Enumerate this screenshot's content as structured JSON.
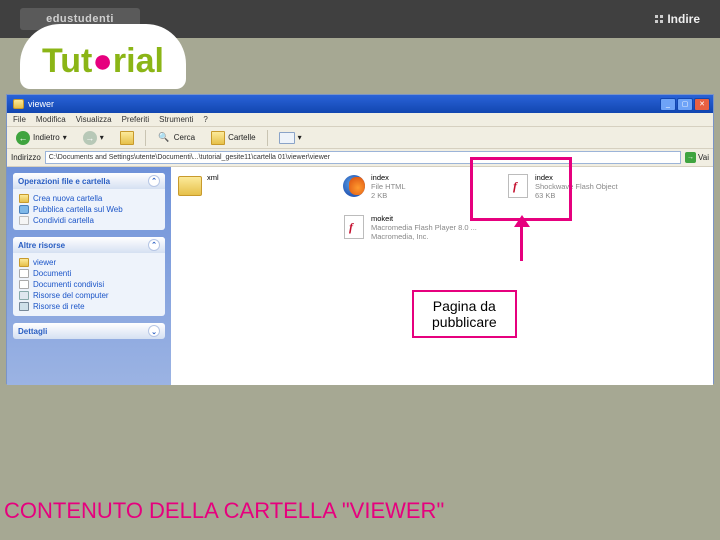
{
  "header": {
    "brand_left": "edustudenti",
    "brand_right": "Indire"
  },
  "tutorial": {
    "pre": "Tut",
    "dot": "●",
    "post": "rial"
  },
  "window": {
    "title": "viewer",
    "win_buttons": {
      "min": "_",
      "max": "▢",
      "close": "✕"
    },
    "menus": [
      "File",
      "Modifica",
      "Visualizza",
      "Preferiti",
      "Strumenti",
      "?"
    ],
    "toolbar": {
      "back": "Indietro",
      "search": "Cerca",
      "folders": "Cartelle"
    },
    "addressbar": {
      "label": "Indirizzo",
      "value": "C:\\Documents and Settings\\utente\\Documenti\\...\\tutorial_gesite11\\cartella 01\\viewer\\viewer",
      "go": "Vai"
    },
    "leftpane": {
      "tasks": {
        "title": "Operazioni file e cartella",
        "items": [
          "Crea nuova cartella",
          "Pubblica cartella sul Web",
          "Condividi cartella"
        ]
      },
      "places": {
        "title": "Altre risorse",
        "items": [
          "viewer",
          "Documenti",
          "Documenti condivisi",
          "Risorse del computer",
          "Risorse di rete"
        ]
      },
      "details": {
        "title": "Dettagli"
      }
    },
    "files": [
      {
        "name": "xml",
        "meta": "",
        "icon": "folder"
      },
      {
        "name": "index",
        "meta1": "File HTML",
        "meta2": "2 KB",
        "icon": "firefox"
      },
      {
        "name": "index",
        "meta1": "Shockwave Flash Object",
        "meta2": "63 KB",
        "icon": "swf"
      },
      {
        "name": "mokeit",
        "meta1": "Macromedia Flash Player 8.0 ...",
        "meta2": "Macromedia, Inc.",
        "icon": "swf"
      }
    ]
  },
  "callout": {
    "line1": "Pagina da",
    "line2": "pubblicare"
  },
  "caption": "CONTENUTO DELLA CARTELLA \"VIEWER\""
}
